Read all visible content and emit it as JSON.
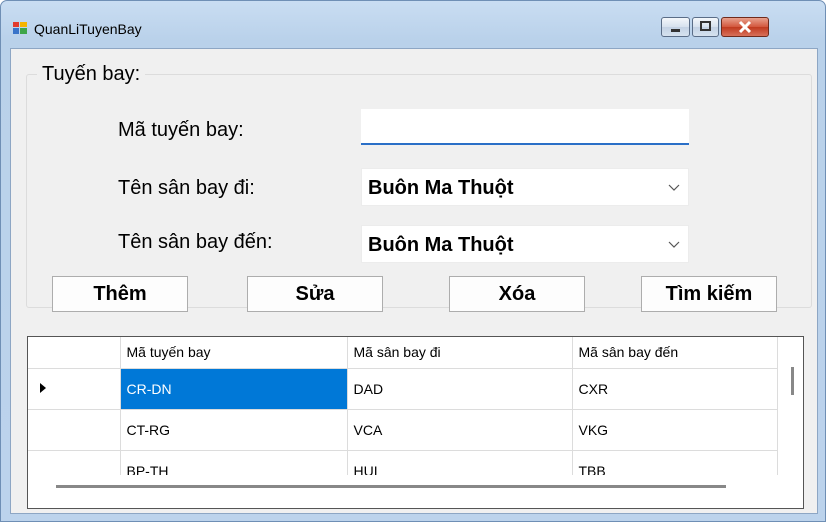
{
  "window": {
    "title": "QuanLiTuyenBay"
  },
  "group": {
    "title": "Tuyến bay:"
  },
  "form": {
    "ma_tuyen_bay_label": "Mã tuyến bay:",
    "ma_tuyen_bay_value": "",
    "san_bay_di_label": "Tên sân bay đi:",
    "san_bay_di_value": "Buôn Ma Thuột",
    "san_bay_den_label": "Tên sân bay đến:",
    "san_bay_den_value": "Buôn Ma Thuột"
  },
  "buttons": {
    "add": "Thêm",
    "edit": "Sửa",
    "delete": "Xóa",
    "search": "Tìm kiếm"
  },
  "grid": {
    "columns": [
      "Mã tuyến bay",
      "Mã sân bay đi",
      "Mã sân bay đến"
    ],
    "rows": [
      [
        "CR-DN",
        "DAD",
        "CXR"
      ],
      [
        "CT-RG",
        "VCA",
        "VKG"
      ],
      [
        "BP-TH",
        "HUI",
        "TBB"
      ]
    ],
    "selection_color": "#0078d7"
  },
  "icons": [
    "app-icon",
    "minimize-icon",
    "maximize-icon",
    "close-icon",
    "chevron-down-icon",
    "row-pointer-icon"
  ]
}
